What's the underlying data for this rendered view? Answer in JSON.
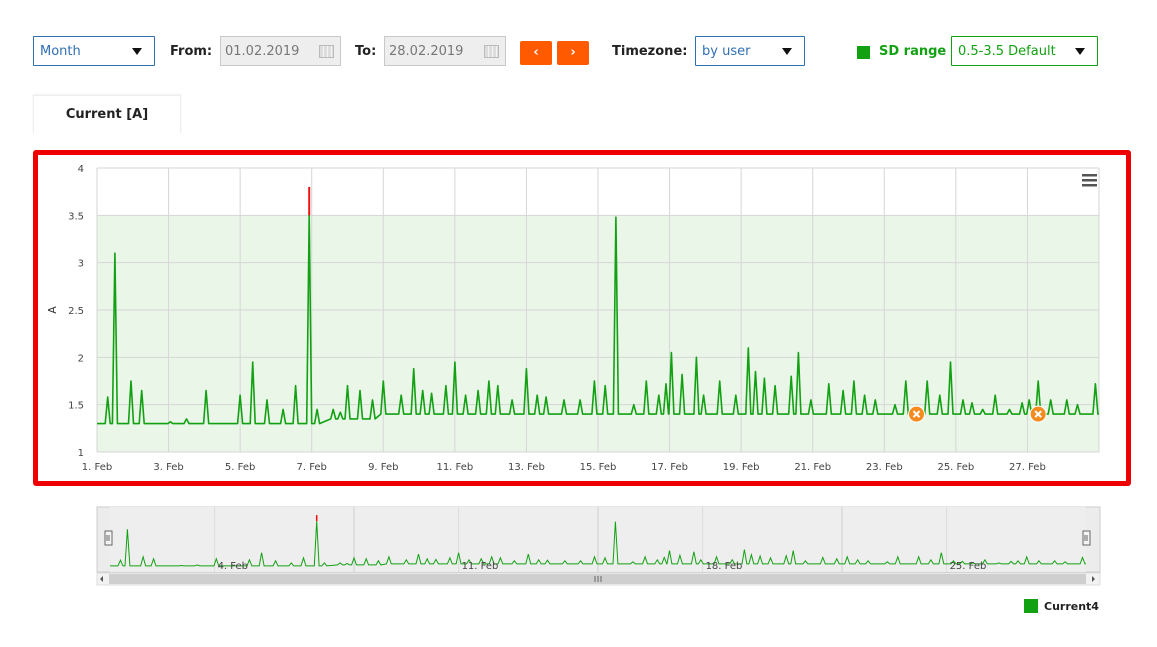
{
  "toolbar": {
    "period": "Month",
    "from_label": "From:",
    "from_value": "01.02.2019",
    "to_label": "To:",
    "to_value": "28.02.2019",
    "prev": "‹",
    "next": "›",
    "timezone_label": "Timezone:",
    "timezone_value": "by user",
    "sd_label": "SD range",
    "sd_value": "0.5-3.5 Default",
    "sd_color": "#12a112",
    "nav_color": "#ff5a00"
  },
  "tabs": [
    {
      "label": "Current [A]"
    }
  ],
  "legend": {
    "label": "Current4"
  },
  "chart_data": {
    "type": "line",
    "title": "",
    "xlabel": "",
    "ylabel": "A",
    "ylim": [
      1,
      4
    ],
    "yticks": [
      "1",
      "1.5",
      "2",
      "2.5",
      "3",
      "3.5",
      "4"
    ],
    "xlim_days": [
      1,
      29
    ],
    "xticks": [
      {
        "day": 1,
        "label": "1. Feb"
      },
      {
        "day": 3,
        "label": "3. Feb"
      },
      {
        "day": 5,
        "label": "5. Feb"
      },
      {
        "day": 7,
        "label": "7. Feb"
      },
      {
        "day": 9,
        "label": "9. Feb"
      },
      {
        "day": 11,
        "label": "11. Feb"
      },
      {
        "day": 13,
        "label": "13. Feb"
      },
      {
        "day": 15,
        "label": "15. Feb"
      },
      {
        "day": 17,
        "label": "17. Feb"
      },
      {
        "day": 19,
        "label": "19. Feb"
      },
      {
        "day": 21,
        "label": "21. Feb"
      },
      {
        "day": 23,
        "label": "23. Feb"
      },
      {
        "day": 25,
        "label": "25. Feb"
      },
      {
        "day": 27,
        "label": "27. Feb"
      }
    ],
    "sd_band": [
      0.5,
      3.5
    ],
    "line_color": "#12a112",
    "band_color": "#eaf6e8",
    "exceed_color": "#ee1111",
    "marker_color": "#f58a1f",
    "baseline": 1.3,
    "peaks": [
      [
        1.3,
        1.58
      ],
      [
        1.5,
        3.1
      ],
      [
        1.95,
        1.75
      ],
      [
        2.25,
        1.65
      ],
      [
        3.05,
        1.32
      ],
      [
        3.5,
        1.35
      ],
      [
        4.05,
        1.65
      ],
      [
        5.0,
        1.6
      ],
      [
        5.35,
        1.95
      ],
      [
        5.75,
        1.55
      ],
      [
        6.2,
        1.45
      ],
      [
        6.55,
        1.7
      ],
      [
        6.93,
        3.8
      ],
      [
        7.15,
        1.45
      ],
      [
        7.6,
        1.45
      ],
      [
        7.8,
        1.42
      ],
      [
        8.0,
        1.7
      ],
      [
        8.35,
        1.65
      ],
      [
        8.7,
        1.55
      ],
      [
        9.0,
        1.75
      ],
      [
        9.5,
        1.6
      ],
      [
        9.85,
        1.88
      ],
      [
        10.1,
        1.65
      ],
      [
        10.35,
        1.62
      ],
      [
        10.75,
        1.7
      ],
      [
        11.0,
        1.95
      ],
      [
        11.3,
        1.6
      ],
      [
        11.65,
        1.65
      ],
      [
        11.95,
        1.75
      ],
      [
        12.2,
        1.7
      ],
      [
        12.6,
        1.55
      ],
      [
        13.0,
        1.88
      ],
      [
        13.3,
        1.6
      ],
      [
        13.55,
        1.58
      ],
      [
        14.05,
        1.55
      ],
      [
        14.5,
        1.55
      ],
      [
        14.9,
        1.75
      ],
      [
        15.2,
        1.7
      ],
      [
        15.5,
        3.48
      ],
      [
        16.0,
        1.5
      ],
      [
        16.35,
        1.75
      ],
      [
        16.7,
        1.6
      ],
      [
        16.9,
        1.72
      ],
      [
        17.05,
        2.05
      ],
      [
        17.35,
        1.82
      ],
      [
        17.75,
        2.0
      ],
      [
        17.95,
        1.6
      ],
      [
        18.4,
        1.75
      ],
      [
        18.85,
        1.6
      ],
      [
        19.2,
        2.1
      ],
      [
        19.4,
        1.85
      ],
      [
        19.65,
        1.78
      ],
      [
        19.95,
        1.7
      ],
      [
        20.4,
        1.8
      ],
      [
        20.6,
        2.05
      ],
      [
        20.95,
        1.55
      ],
      [
        21.45,
        1.72
      ],
      [
        21.85,
        1.65
      ],
      [
        22.15,
        1.75
      ],
      [
        22.45,
        1.6
      ],
      [
        22.75,
        1.55
      ],
      [
        23.3,
        1.5
      ],
      [
        23.6,
        1.75
      ],
      [
        24.2,
        1.75
      ],
      [
        24.55,
        1.6
      ],
      [
        24.85,
        1.95
      ],
      [
        25.2,
        1.55
      ],
      [
        25.45,
        1.52
      ],
      [
        25.75,
        1.45
      ],
      [
        26.1,
        1.6
      ],
      [
        26.5,
        1.45
      ],
      [
        26.85,
        1.52
      ],
      [
        27.05,
        1.55
      ],
      [
        27.3,
        1.75
      ],
      [
        27.65,
        1.55
      ],
      [
        28.1,
        1.55
      ],
      [
        28.4,
        1.5
      ],
      [
        28.9,
        1.72
      ]
    ],
    "markers": [
      [
        23.9,
        1.4
      ],
      [
        27.3,
        1.4
      ]
    ]
  }
}
